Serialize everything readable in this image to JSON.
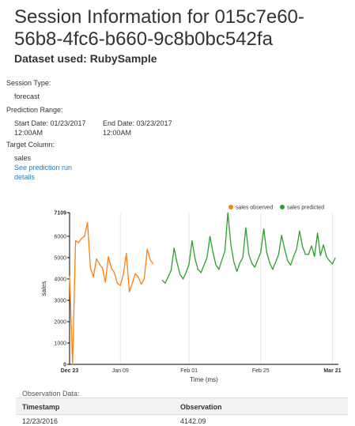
{
  "page": {
    "title": "Session Information for 015c7e60-56b8-4fc6-b660-9c8b0bc542fa",
    "dataset": "Dataset used: RubySample"
  },
  "session": {
    "type_label": "Session Type:",
    "type_value": "forecast",
    "range_label": "Prediction Range:",
    "start_date": "Start Date: 01/23/2017",
    "start_time": "12:00AM",
    "end_date": "End Date: 03/23/2017",
    "end_time": "12:00AM",
    "target_label": "Target Column:",
    "target_value": "sales",
    "details_link_line1": "See prediction run",
    "details_link_line2": "details"
  },
  "chart_data": {
    "type": "line",
    "xlabel": "Time (ms)",
    "ylabel": "sales",
    "ylim": [
      0,
      7109
    ],
    "yticks": [
      "0",
      "1000",
      "2000",
      "3000",
      "4000",
      "5000",
      "6000",
      "7109"
    ],
    "x_range": [
      "2016-12-23",
      "2017-03-23"
    ],
    "xticks": [
      {
        "label": "Dec 23",
        "date": "2016-12-23",
        "bold": true
      },
      {
        "label": "Jan 09",
        "date": "2017-01-09",
        "bold": false
      },
      {
        "label": "Feb 01",
        "date": "2017-02-01",
        "bold": false
      },
      {
        "label": "Feb 25",
        "date": "2017-02-25",
        "bold": false
      },
      {
        "label": "Mar 21",
        "date": "2017-03-21",
        "bold": true
      }
    ],
    "legend_position": "top-right",
    "grid": "vertical",
    "series": [
      {
        "name": "sales observed",
        "color": "#ff7f0e",
        "points": [
          [
            "2016-12-23",
            4142
          ],
          [
            "2016-12-24",
            0
          ],
          [
            "2016-12-25",
            5800
          ],
          [
            "2016-12-26",
            5700
          ],
          [
            "2016-12-27",
            5900
          ],
          [
            "2016-12-28",
            6000
          ],
          [
            "2016-12-29",
            6650
          ],
          [
            "2016-12-30",
            4500
          ],
          [
            "2016-12-31",
            4100
          ],
          [
            "2017-01-01",
            4950
          ],
          [
            "2017-01-02",
            4700
          ],
          [
            "2017-01-03",
            4500
          ],
          [
            "2017-01-04",
            3850
          ],
          [
            "2017-01-05",
            5050
          ],
          [
            "2017-01-06",
            4500
          ],
          [
            "2017-01-07",
            4300
          ],
          [
            "2017-01-08",
            3800
          ],
          [
            "2017-01-09",
            3700
          ],
          [
            "2017-01-10",
            4200
          ],
          [
            "2017-01-11",
            5200
          ],
          [
            "2017-01-12",
            3400
          ],
          [
            "2017-01-13",
            3800
          ],
          [
            "2017-01-14",
            4250
          ],
          [
            "2017-01-15",
            4100
          ],
          [
            "2017-01-16",
            3750
          ],
          [
            "2017-01-17",
            4000
          ],
          [
            "2017-01-18",
            5400
          ],
          [
            "2017-01-19",
            4900
          ],
          [
            "2017-01-20",
            4700
          ]
        ]
      },
      {
        "name": "sales predicted",
        "color": "#2ca02c",
        "points": [
          [
            "2017-01-23",
            3950
          ],
          [
            "2017-01-24",
            3800
          ],
          [
            "2017-01-25",
            4100
          ],
          [
            "2017-01-26",
            4400
          ],
          [
            "2017-01-27",
            5450
          ],
          [
            "2017-01-28",
            4750
          ],
          [
            "2017-01-29",
            4200
          ],
          [
            "2017-01-30",
            4000
          ],
          [
            "2017-01-31",
            4300
          ],
          [
            "2017-02-01",
            4700
          ],
          [
            "2017-02-02",
            5800
          ],
          [
            "2017-02-03",
            4950
          ],
          [
            "2017-02-04",
            4450
          ],
          [
            "2017-02-05",
            4300
          ],
          [
            "2017-02-06",
            4650
          ],
          [
            "2017-02-07",
            5000
          ],
          [
            "2017-02-08",
            6000
          ],
          [
            "2017-02-09",
            5250
          ],
          [
            "2017-02-10",
            4650
          ],
          [
            "2017-02-11",
            4450
          ],
          [
            "2017-02-12",
            4900
          ],
          [
            "2017-02-13",
            5300
          ],
          [
            "2017-02-14",
            7100
          ],
          [
            "2017-02-15",
            5600
          ],
          [
            "2017-02-16",
            4800
          ],
          [
            "2017-02-17",
            4350
          ],
          [
            "2017-02-18",
            4750
          ],
          [
            "2017-02-19",
            5000
          ],
          [
            "2017-02-20",
            6400
          ],
          [
            "2017-02-21",
            5150
          ],
          [
            "2017-02-22",
            4750
          ],
          [
            "2017-02-23",
            4550
          ],
          [
            "2017-02-24",
            4900
          ],
          [
            "2017-02-25",
            5250
          ],
          [
            "2017-02-26",
            6350
          ],
          [
            "2017-02-27",
            5250
          ],
          [
            "2017-02-28",
            4750
          ],
          [
            "2017-03-01",
            4450
          ],
          [
            "2017-03-02",
            4800
          ],
          [
            "2017-03-03",
            5150
          ],
          [
            "2017-03-04",
            6050
          ],
          [
            "2017-03-05",
            5400
          ],
          [
            "2017-03-06",
            4850
          ],
          [
            "2017-03-07",
            4650
          ],
          [
            "2017-03-08",
            5050
          ],
          [
            "2017-03-09",
            5400
          ],
          [
            "2017-03-10",
            6250
          ],
          [
            "2017-03-11",
            5500
          ],
          [
            "2017-03-12",
            5150
          ],
          [
            "2017-03-13",
            5150
          ],
          [
            "2017-03-14",
            5550
          ],
          [
            "2017-03-15",
            5050
          ],
          [
            "2017-03-16",
            6150
          ],
          [
            "2017-03-17",
            5100
          ],
          [
            "2017-03-18",
            5600
          ],
          [
            "2017-03-19",
            5050
          ],
          [
            "2017-03-20",
            4850
          ],
          [
            "2017-03-21",
            4700
          ],
          [
            "2017-03-22",
            5000
          ]
        ]
      }
    ]
  },
  "observation": {
    "title": "Observation Data:",
    "columns": [
      "Timestamp",
      "Observation"
    ],
    "rows": [
      [
        "12/23/2016",
        "4142.09"
      ]
    ]
  }
}
